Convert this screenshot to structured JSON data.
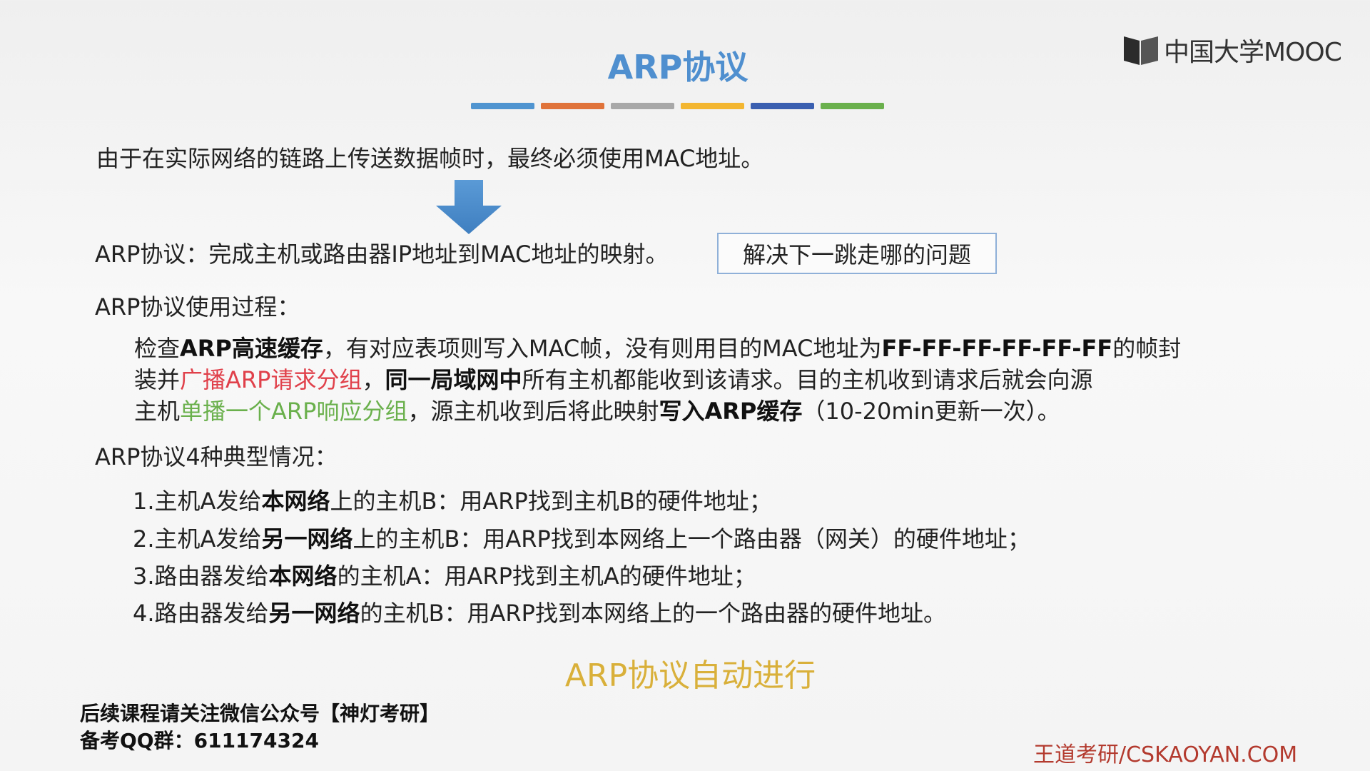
{
  "logo": {
    "icon": "mooc-book-icon",
    "text": "中国大学MOOC"
  },
  "title": "ARP协议",
  "title_bar_colors": [
    "#4f94d0",
    "#e0733a",
    "#a8a8a8",
    "#f3b630",
    "#3a5fb0",
    "#6ab04c"
  ],
  "intro": "由于在实际网络的链路上传送数据帧时，最终必须使用MAC地址。",
  "arrow_icon": "down-arrow-icon",
  "definition": {
    "prefix": "ARP协议：完成主机或路由器IP地址到MAC地址的映射。",
    "callout": "解决下一跳走哪的问题"
  },
  "process": {
    "heading": "ARP协议使用过程：",
    "l1_a": "检查",
    "l1_b": "ARP高速缓存",
    "l1_c": "，有对应表项则写入MAC帧，没有则用目的MAC地址为",
    "l1_d": "FF-FF-FF-FF-FF-FF",
    "l1_e": "的帧封",
    "l2_a": "装并",
    "l2_b": "广播ARP请求分组",
    "l2_c": "，",
    "l2_d": "同一局域网中",
    "l2_e": "所有主机都能收到该请求。目的主机收到请求后就会向源",
    "l3_a": "主机",
    "l3_b": "单播一个ARP响应分组",
    "l3_c": "，源主机收到后将此映射",
    "l3_d": "写入ARP缓存",
    "l3_e": "（10-20min更新一次）。"
  },
  "cases": {
    "heading": "ARP协议4种典型情况：",
    "c1_a": "1.主机A发给",
    "c1_b": "本网络",
    "c1_c": "上的主机B：用ARP找到主机B的硬件地址；",
    "c2_a": "2.主机A发给",
    "c2_b": "另一网络",
    "c2_c": "上的主机B：用ARP找到本网络上一个路由器（网关）的硬件地址；",
    "c3_a": "3.路由器发给",
    "c3_b": "本网络",
    "c3_c": "的主机A：用ARP找到主机A的硬件地址；",
    "c4_a": "4.路由器发给",
    "c4_b": "另一网络",
    "c4_c": "的主机B：用ARP找到本网络上的一个路由器的硬件地址。"
  },
  "auto_note": "ARP协议自动进行",
  "footer": {
    "line1": "后续课程请关注微信公众号【神灯考研】",
    "line2": "备考QQ群：611174324",
    "brand": "王道考研/CSKAOYAN.COM"
  }
}
